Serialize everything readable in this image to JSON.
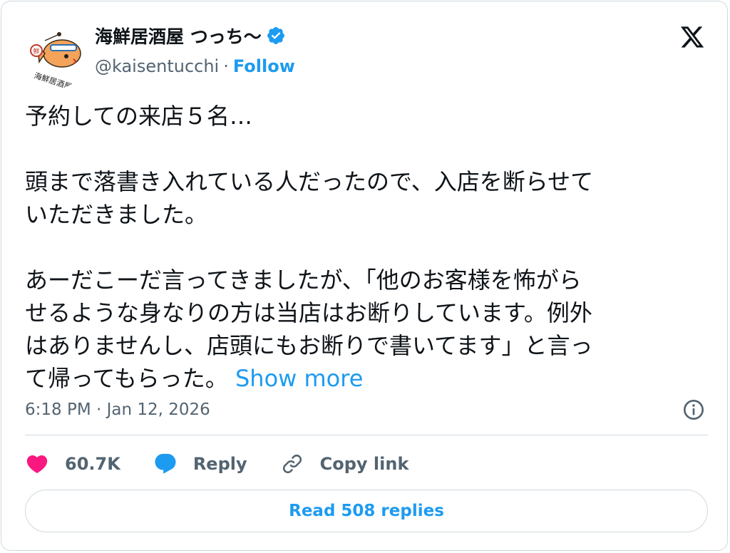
{
  "author": {
    "display_name": "海鮮居酒屋 つっち〜",
    "handle": "@kaisentucchi",
    "separator": "·",
    "follow_label": "Follow",
    "avatar_text": "海鮮居酒屋 つっち〜"
  },
  "tweet": {
    "body": "予約しての来店５名…\n\n頭まで落書き入れている人だったので、入店を断らせて\nいただきました。\n\nあーだこーだ言ってきましたが、「他のお客様を怖がら\nせるような身なりの方は当店はお断りしています。例外\nはありませんし、店頭にもお断りで書いてます」と言っ\nて帰ってもらった。 ",
    "show_more": "Show more",
    "timestamp": "6:18 PM · Jan 12, 2026"
  },
  "actions": {
    "likes": "60.7K",
    "reply_label": "Reply",
    "copy_link_label": "Copy link"
  },
  "read_replies_label": "Read 508 replies",
  "colors": {
    "accent": "#1d9bf0",
    "like": "#f91880",
    "muted": "#536471",
    "text": "#0f1419",
    "border": "#cfd9de"
  },
  "icons": [
    "verified-badge-icon",
    "x-logo-icon",
    "info-icon",
    "heart-icon",
    "reply-bubble-icon",
    "link-icon"
  ]
}
